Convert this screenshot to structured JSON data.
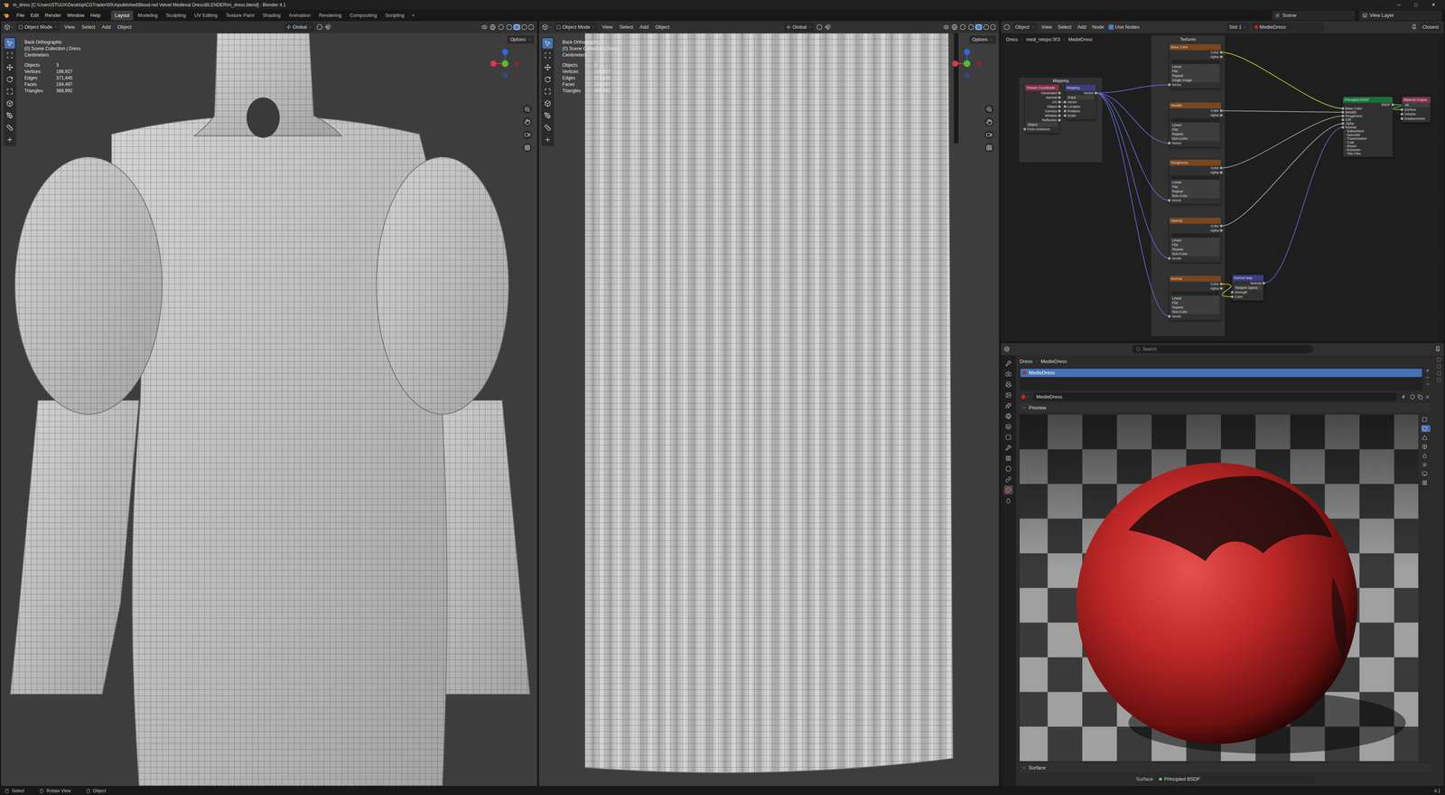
{
  "window": {
    "title": "m_dress [C:\\Users\\STUUX\\Desktop\\CGTrader\\00Unpublished\\Blood-red Velvet Medieval Dress\\BLENDER\\m_dress.blend] - Blender 4.1",
    "controls": [
      "─",
      "□",
      "✕"
    ]
  },
  "menu": [
    "File",
    "Edit",
    "Render",
    "Window",
    "Help"
  ],
  "workspaces": [
    {
      "label": "Layout",
      "selected": true
    },
    {
      "label": "Modeling",
      "selected": false
    },
    {
      "label": "Sculpting",
      "selected": false
    },
    {
      "label": "UV Editing",
      "selected": false
    },
    {
      "label": "Texture Paint",
      "selected": false
    },
    {
      "label": "Shading",
      "selected": false
    },
    {
      "label": "Animation",
      "selected": false
    },
    {
      "label": "Rendering",
      "selected": false
    },
    {
      "label": "Compositing",
      "selected": false
    },
    {
      "label": "Scripting",
      "selected": false
    }
  ],
  "add_workspace": "+",
  "scene": "Scene",
  "view_layer": "View Layer",
  "viewports": [
    {
      "kind": "bodice",
      "mode": "Object Mode",
      "menus": [
        "View",
        "Select",
        "Add",
        "Object"
      ],
      "orientation": "Global",
      "options": "Options",
      "view": "Back Orthographic",
      "collection": "(0) Scene Collection | Dress",
      "units": "Centimeters",
      "stats": [
        {
          "label": "Objects",
          "value": "3"
        },
        {
          "label": "Vertices",
          "value": "186,927"
        },
        {
          "label": "Edges",
          "value": "371,445"
        },
        {
          "label": "Faces",
          "value": "184,497"
        },
        {
          "label": "Triangles",
          "value": "368,992"
        }
      ]
    },
    {
      "kind": "skirt",
      "mode": "Object Mode",
      "menus": [
        "View",
        "Select",
        "Add",
        "Object"
      ],
      "orientation": "Global",
      "options": "Options",
      "view": "Back Orthographic",
      "collection": "(0) Scene Collection | Dress",
      "units": "Centimeters",
      "stats": [
        {
          "label": "Objects",
          "value": "3"
        },
        {
          "label": "Vertices",
          "value": "186,927"
        },
        {
          "label": "Edges",
          "value": "371,445"
        },
        {
          "label": "Faces",
          "value": "184,497"
        },
        {
          "label": "Triangles",
          "value": "368,992"
        }
      ]
    }
  ],
  "node_editor": {
    "object": "Object",
    "menus": [
      "View",
      "Select",
      "Add",
      "Node"
    ],
    "use_nodes": {
      "label": "Use Nodes",
      "checked": true
    },
    "slot": "Slot 1",
    "material": "MedieDress",
    "snap": "Closest",
    "breadcrumb": [
      "Dress",
      "medi_retopo.003",
      "MedieDress"
    ],
    "frames": [
      "Mapping",
      "Textures"
    ],
    "nodes": [
      {
        "title": "Texture Coordinate",
        "kind": "input",
        "rows": [
          {
            "label": "Generated",
            "kind": "out"
          },
          {
            "label": "Normal",
            "kind": "out"
          },
          {
            "label": "UV",
            "kind": "out"
          },
          {
            "label": "Object",
            "kind": "out"
          },
          {
            "label": "Camera",
            "kind": "out"
          },
          {
            "label": "Window",
            "kind": "out"
          },
          {
            "label": "Reflection",
            "kind": "out"
          },
          {
            "label": "Object",
            "kind": "param"
          },
          {
            "label": "From Instancer",
            "kind": "in"
          }
        ]
      },
      {
        "title": "Mapping",
        "kind": "vector",
        "rows": [
          {
            "label": "Vector",
            "kind": "out"
          },
          {
            "label": "Point",
            "kind": "param"
          },
          {
            "label": "Vector",
            "kind": "in"
          },
          {
            "label": "Location",
            "kind": "in"
          },
          {
            "label": "Rotation",
            "kind": "in"
          },
          {
            "label": "Scale",
            "kind": "in"
          }
        ]
      },
      {
        "title": "Base Color",
        "kind": "texture",
        "rows": [
          {
            "label": "Color",
            "kind": "out"
          },
          {
            "label": "Alpha",
            "kind": "out"
          },
          {
            "label": "Linear",
            "kind": "param"
          },
          {
            "label": "Flat",
            "kind": "param"
          },
          {
            "label": "Repeat",
            "kind": "param"
          },
          {
            "label": "Single Image",
            "kind": "param"
          },
          {
            "label": "Vector",
            "kind": "in"
          }
        ]
      },
      {
        "title": "Metallic",
        "kind": "texture",
        "rows": [
          {
            "label": "Color",
            "kind": "out"
          },
          {
            "label": "Alpha",
            "kind": "out"
          },
          {
            "label": "Linear",
            "kind": "param"
          },
          {
            "label": "Flat",
            "kind": "param"
          },
          {
            "label": "Repeat",
            "kind": "param"
          },
          {
            "label": "Non-Color",
            "kind": "param"
          },
          {
            "label": "Vector",
            "kind": "in"
          }
        ]
      },
      {
        "title": "Roughness",
        "kind": "texture",
        "rows": [
          {
            "label": "Color",
            "kind": "out"
          },
          {
            "label": "Alpha",
            "kind": "out"
          },
          {
            "label": "Linear",
            "kind": "param"
          },
          {
            "label": "Flat",
            "kind": "param"
          },
          {
            "label": "Repeat",
            "kind": "param"
          },
          {
            "label": "Non-Color",
            "kind": "param"
          },
          {
            "label": "Vector",
            "kind": "in"
          }
        ]
      },
      {
        "title": "Opacity",
        "kind": "texture",
        "rows": [
          {
            "label": "Color",
            "kind": "out"
          },
          {
            "label": "Alpha",
            "kind": "out"
          },
          {
            "label": "Linear",
            "kind": "param"
          },
          {
            "label": "Flat",
            "kind": "param"
          },
          {
            "label": "Repeat",
            "kind": "param"
          },
          {
            "label": "Non-Color",
            "kind": "param"
          },
          {
            "label": "Vector",
            "kind": "in"
          }
        ]
      },
      {
        "title": "Normal",
        "kind": "texture",
        "rows": [
          {
            "label": "Color",
            "kind": "out"
          },
          {
            "label": "Alpha",
            "kind": "out"
          },
          {
            "label": "Linear",
            "kind": "param"
          },
          {
            "label": "Flat",
            "kind": "param"
          },
          {
            "label": "Repeat",
            "kind": "param"
          },
          {
            "label": "Non-Color",
            "kind": "param"
          },
          {
            "label": "Vector",
            "kind": "in"
          }
        ]
      },
      {
        "title": "Normal Map",
        "kind": "vector",
        "rows": [
          {
            "label": "Normal",
            "kind": "out"
          },
          {
            "label": "Tangent Space",
            "kind": "param"
          },
          {
            "label": "Strength",
            "kind": "in"
          },
          {
            "label": "Color",
            "kind": "in"
          }
        ]
      },
      {
        "title": "Principled BSDF",
        "kind": "shader",
        "rows": [
          {
            "label": "BSDF",
            "kind": "out"
          },
          {
            "label": "Base Color",
            "kind": "in"
          },
          {
            "label": "Metallic",
            "kind": "in"
          },
          {
            "label": "Roughness",
            "kind": "in"
          },
          {
            "label": "IOR",
            "kind": "in"
          },
          {
            "label": "Alpha",
            "kind": "in"
          },
          {
            "label": "Normal",
            "kind": "in"
          },
          {
            "label": "Subsurface",
            "kind": "panel"
          },
          {
            "label": "Specular",
            "kind": "panel"
          },
          {
            "label": "Transmission",
            "kind": "panel"
          },
          {
            "label": "Coat",
            "kind": "panel"
          },
          {
            "label": "Sheen",
            "kind": "panel"
          },
          {
            "label": "Emission",
            "kind": "panel"
          },
          {
            "label": "Thin Film",
            "kind": "panel"
          }
        ]
      },
      {
        "title": "Material Output",
        "kind": "output",
        "rows": [
          {
            "label": "All",
            "kind": "param"
          },
          {
            "label": "Surface",
            "kind": "in"
          },
          {
            "label": "Volume",
            "kind": "in"
          },
          {
            "label": "Displacement",
            "kind": "in"
          }
        ]
      }
    ]
  },
  "properties": {
    "search": "Search",
    "breadcrumb": [
      "Dress",
      "MedieDress"
    ],
    "slots": [
      {
        "label": "MedieDress",
        "selected": true
      }
    ],
    "material": "MedieDress",
    "users": "4",
    "tabs": [
      {
        "selected": false
      },
      {
        "selected": false
      },
      {
        "selected": false
      },
      {
        "selected": false
      },
      {
        "selected": false
      },
      {
        "selected": false
      },
      {
        "selected": false
      },
      {
        "selected": false
      },
      {
        "selected": false
      },
      {
        "selected": false
      },
      {
        "selected": false
      },
      {
        "selected": false
      },
      {
        "selected": true
      },
      {
        "selected": false
      }
    ],
    "preview": "Preview",
    "surface_panel": "Surface",
    "surface": {
      "label": "Surface",
      "value": "Principled BSDF"
    }
  },
  "status_bar": {
    "items": [
      "Select",
      "Rotate View",
      "Object"
    ],
    "version": "4.1"
  }
}
